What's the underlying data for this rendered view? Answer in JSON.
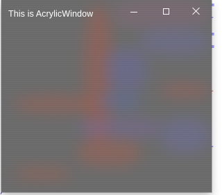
{
  "window": {
    "title": "This is AcrylicWindow",
    "tint_color": "#6b6b6b",
    "title_color": "#ffffff",
    "caption_buttons": [
      {
        "name": "minimize",
        "icon": "minimize-icon"
      },
      {
        "name": "maximize",
        "icon": "maximize-icon"
      },
      {
        "name": "close",
        "icon": "close-icon"
      }
    ]
  },
  "background_editor": {
    "text_colors": {
      "blue": "#2b2bff",
      "red": "#c03a2b"
    }
  }
}
